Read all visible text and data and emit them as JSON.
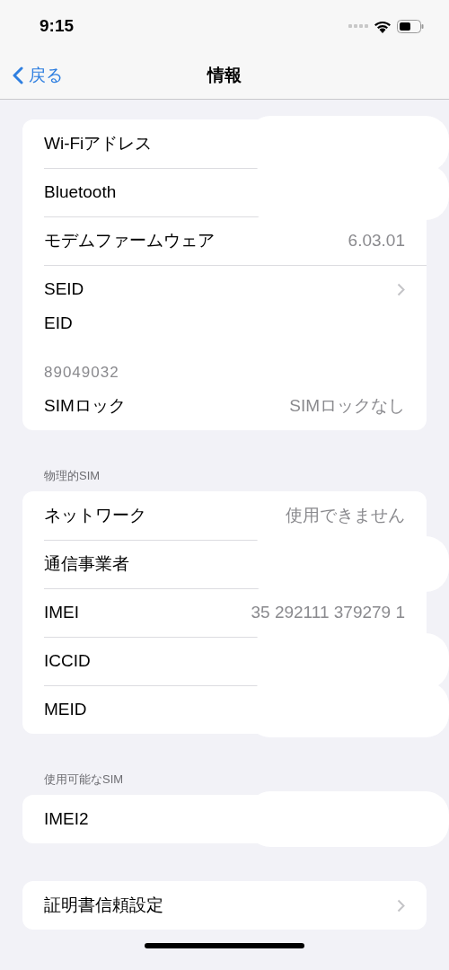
{
  "status_bar": {
    "time": "9:15"
  },
  "nav": {
    "back": "戻る",
    "title": "情報"
  },
  "sections": [
    {
      "rows": [
        {
          "label": "Wi-Fiアドレス",
          "kind": "value",
          "redacted": true
        },
        {
          "label": "Bluetooth",
          "kind": "value",
          "redacted": true
        },
        {
          "label": "モデムファームウェア",
          "kind": "value",
          "value": "6.03.01"
        },
        {
          "label": "SEID",
          "kind": "link"
        },
        {
          "label": "EID",
          "kind": "stacked",
          "value": "89049032"
        },
        {
          "label": "SIMロック",
          "kind": "value",
          "value": "SIMロックなし"
        }
      ]
    },
    {
      "header": "物理的SIM",
      "rows": [
        {
          "label": "ネットワーク",
          "kind": "value",
          "value": "使用できません"
        },
        {
          "label": "通信事業者",
          "kind": "value",
          "redacted": true
        },
        {
          "label": "IMEI",
          "kind": "value",
          "value": "35 292111 379279 1"
        },
        {
          "label": "ICCID",
          "kind": "value",
          "redacted": true
        },
        {
          "label": "MEID",
          "kind": "value",
          "redacted": true
        }
      ]
    },
    {
      "header": "使用可能なSIM",
      "rows": [
        {
          "label": "IMEI2",
          "kind": "value",
          "redacted": true
        }
      ]
    },
    {
      "rows": [
        {
          "label": "証明書信頼設定",
          "kind": "link"
        }
      ]
    }
  ]
}
